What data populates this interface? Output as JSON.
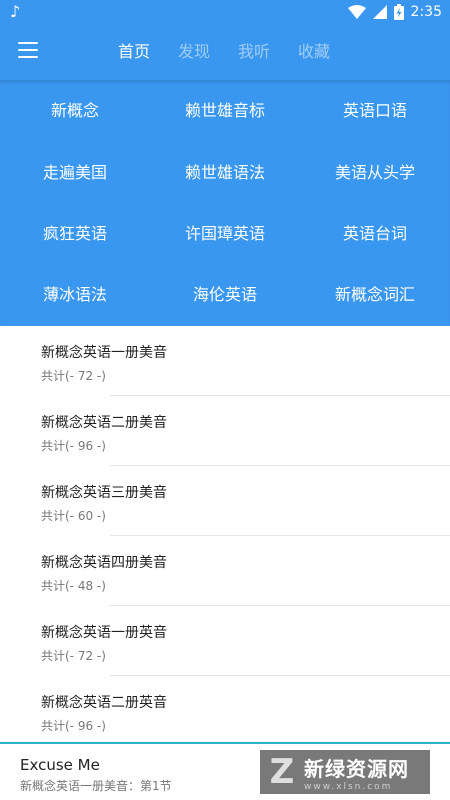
{
  "status": {
    "time": "2:35"
  },
  "tabs": [
    "首页",
    "发现",
    "我听",
    "收藏"
  ],
  "categories": [
    "新概念",
    "赖世雄音标",
    "英语口语",
    "走遍美国",
    "赖世雄语法",
    "美语从头学",
    "疯狂英语",
    "许国璋英语",
    "英语台词",
    "薄冰语法",
    "海伦英语",
    "新概念词汇"
  ],
  "items": [
    {
      "title": "新概念英语一册美音",
      "count": "共计(- 72 -)"
    },
    {
      "title": "新概念英语二册美音",
      "count": "共计(- 96 -)"
    },
    {
      "title": "新概念英语三册美音",
      "count": "共计(- 60 -)"
    },
    {
      "title": "新概念英语四册美音",
      "count": "共计(- 48 -)"
    },
    {
      "title": "新概念英语一册英音",
      "count": "共计(- 72 -)"
    },
    {
      "title": "新概念英语二册英音",
      "count": "共计(- 96 -)"
    }
  ],
  "player": {
    "song": "Excuse Me",
    "subtitle": "新概念英语一册美音：第1节"
  },
  "watermark": {
    "cn": "新绿资源网",
    "en": "www.xlsn.com"
  },
  "colors": {
    "primary": "#3a97f0",
    "inactive_tab": "#9fcdf7",
    "player_accent": "#2fb3c4"
  }
}
